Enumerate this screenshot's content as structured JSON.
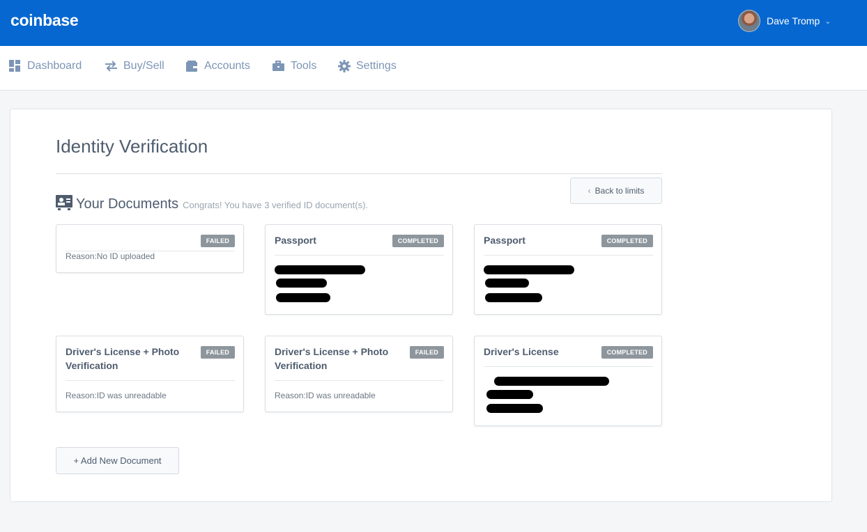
{
  "header": {
    "logo": "coinbase",
    "user_name": "Dave Tromp"
  },
  "nav": {
    "items": [
      {
        "label": "Dashboard",
        "icon": "dashboard-icon"
      },
      {
        "label": "Buy/Sell",
        "icon": "swap-arrows-icon"
      },
      {
        "label": "Accounts",
        "icon": "wallet-icon"
      },
      {
        "label": "Tools",
        "icon": "briefcase-icon"
      },
      {
        "label": "Settings",
        "icon": "gear-icon"
      }
    ]
  },
  "page": {
    "title": "Identity Verification",
    "documents_heading": "Your Documents",
    "documents_subtitle": "Congrats! You have 3 verified ID document(s).",
    "back_button": "Back to limits",
    "add_button": "+ Add New Document"
  },
  "documents": [
    {
      "title": "",
      "status": "FAILED",
      "reason": "Reason:No ID uploaded"
    },
    {
      "title": "Passport",
      "status": "COMPLETED",
      "details_redacted": true
    },
    {
      "title": "Passport",
      "status": "COMPLETED",
      "details_redacted": true
    },
    {
      "title": "Driver's License + Photo Verification",
      "status": "FAILED",
      "reason": "Reason:ID was unreadable"
    },
    {
      "title": "Driver's License + Photo Verification",
      "status": "FAILED",
      "reason": "Reason:ID was unreadable"
    },
    {
      "title": "Driver's License",
      "status": "COMPLETED",
      "details_redacted": true
    }
  ],
  "colors": {
    "brand_blue": "#0667d0",
    "nav_text": "#7d95b6",
    "badge_gray": "#8e969d"
  }
}
